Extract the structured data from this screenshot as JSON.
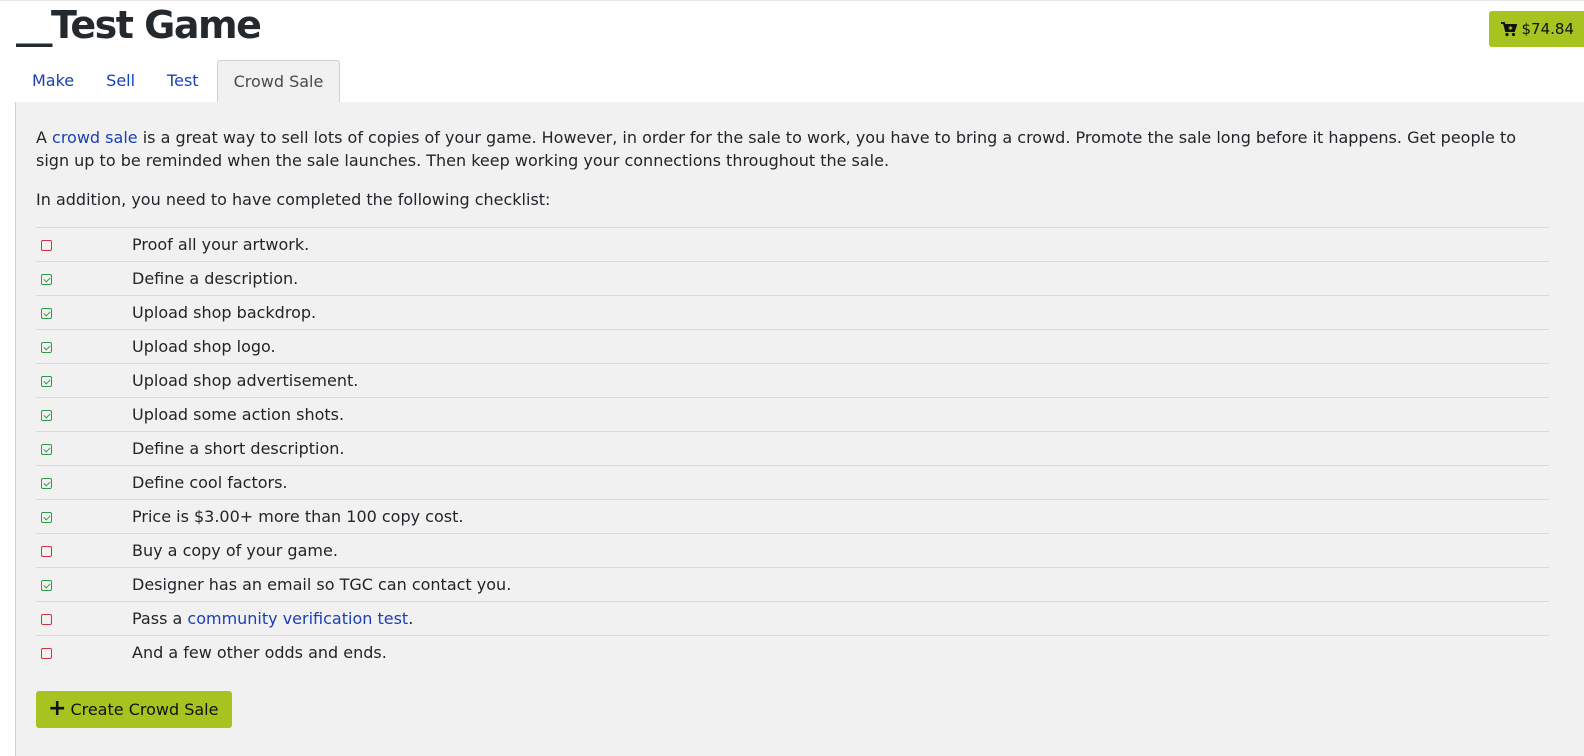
{
  "header": {
    "title_prefix": "__",
    "title": "Test Game",
    "cart_total": "$74.84"
  },
  "tabs": [
    {
      "label": "Make",
      "active": false
    },
    {
      "label": "Sell",
      "active": false
    },
    {
      "label": "Test",
      "active": false
    },
    {
      "label": "Crowd Sale",
      "active": true
    }
  ],
  "intro": {
    "before_link": "A ",
    "link_text": "crowd sale",
    "after_link": " is a great way to sell lots of copies of your game. However, in order for the sale to work, you have to bring a crowd. Promote the sale long before it happens. Get people to sign up to be reminded when the sale launches. Then keep working your connections throughout the sale."
  },
  "checklist_intro": "In addition, you need to have completed the following checklist:",
  "checklist": [
    {
      "text": "Proof all your artwork.",
      "done": false
    },
    {
      "text": "Define a description.",
      "done": true
    },
    {
      "text": "Upload shop backdrop.",
      "done": true
    },
    {
      "text": "Upload shop logo.",
      "done": true
    },
    {
      "text": "Upload shop advertisement.",
      "done": true
    },
    {
      "text": "Upload some action shots.",
      "done": true
    },
    {
      "text": "Define a short description.",
      "done": true
    },
    {
      "text": "Define cool factors.",
      "done": true
    },
    {
      "text": "Price is $3.00+ more than 100 copy cost.",
      "done": true
    },
    {
      "text": "Buy a copy of your game.",
      "done": false
    },
    {
      "text": "Designer has an email so TGC can contact you.",
      "done": true
    },
    {
      "text": "Pass a ",
      "link": "community verification test",
      "suffix": ".",
      "done": false
    },
    {
      "text": "And a few other odds and ends.",
      "done": false
    }
  ],
  "create_button": {
    "icon": "plus-icon",
    "label": "Create Crowd Sale"
  },
  "colors": {
    "accent_green": "#a6c31f",
    "link_blue": "#1a3fb5",
    "check_done": "#2e9a4a",
    "check_empty": "#d03245",
    "panel_bg": "#f1f1f1"
  }
}
